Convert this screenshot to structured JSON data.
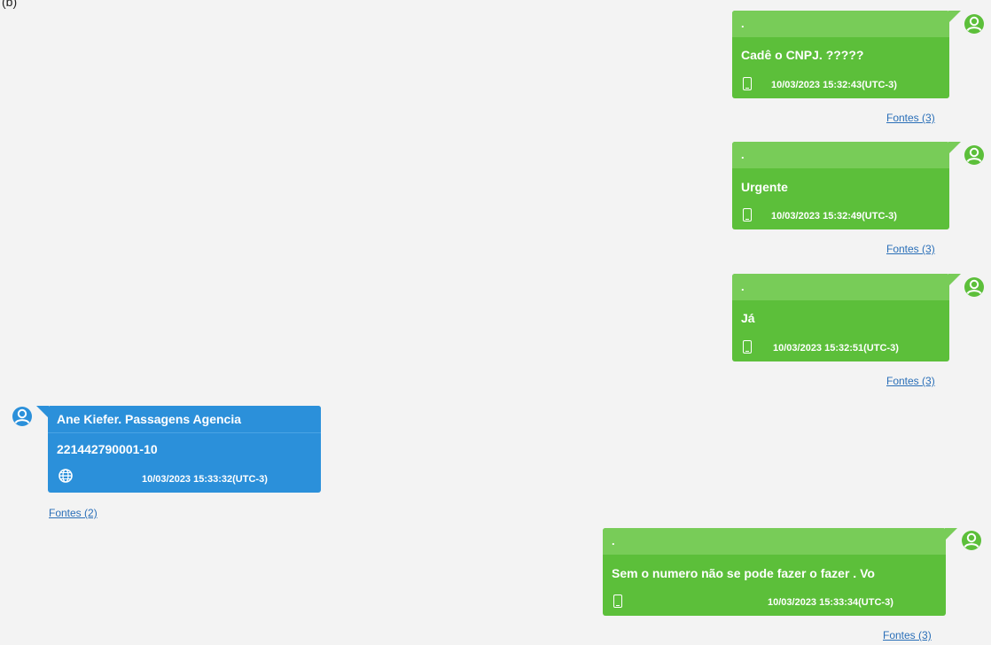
{
  "corner_label": "(b)",
  "colors": {
    "outgoing": "#5cbf3a",
    "outgoing_header": "#78cc58",
    "incoming": "#2b90da",
    "link": "#2a6fb8",
    "background": "#f3f3f3"
  },
  "messages": [
    {
      "direction": "outgoing",
      "sender": ".",
      "text": "Cadê  o CNPJ. ?????",
      "timestamp": "10/03/2023 15:32:43(UTC-3)",
      "source_icon": "phone-icon",
      "sources_link": "Fontes (3)"
    },
    {
      "direction": "outgoing",
      "sender": ".",
      "text": "Urgente",
      "timestamp": "10/03/2023 15:32:49(UTC-3)",
      "source_icon": "phone-icon",
      "sources_link": "Fontes (3)"
    },
    {
      "direction": "outgoing",
      "sender": ".",
      "text": "Já",
      "timestamp": "10/03/2023 15:32:51(UTC-3)",
      "source_icon": "phone-icon",
      "sources_link": "Fontes (3)"
    },
    {
      "direction": "incoming",
      "sender": "Ane Kiefer. Passagens Agencia",
      "text": "221442790001-10",
      "timestamp": "10/03/2023 15:33:32(UTC-3)",
      "source_icon": "globe-icon",
      "sources_link": "Fontes (2)"
    },
    {
      "direction": "outgoing",
      "sender": ".",
      "text": "Sem o numero não se pode fazer o fazer .   Vo",
      "timestamp": "10/03/2023 15:33:34(UTC-3)",
      "source_icon": "phone-icon",
      "sources_link": "Fontes (3)"
    }
  ]
}
